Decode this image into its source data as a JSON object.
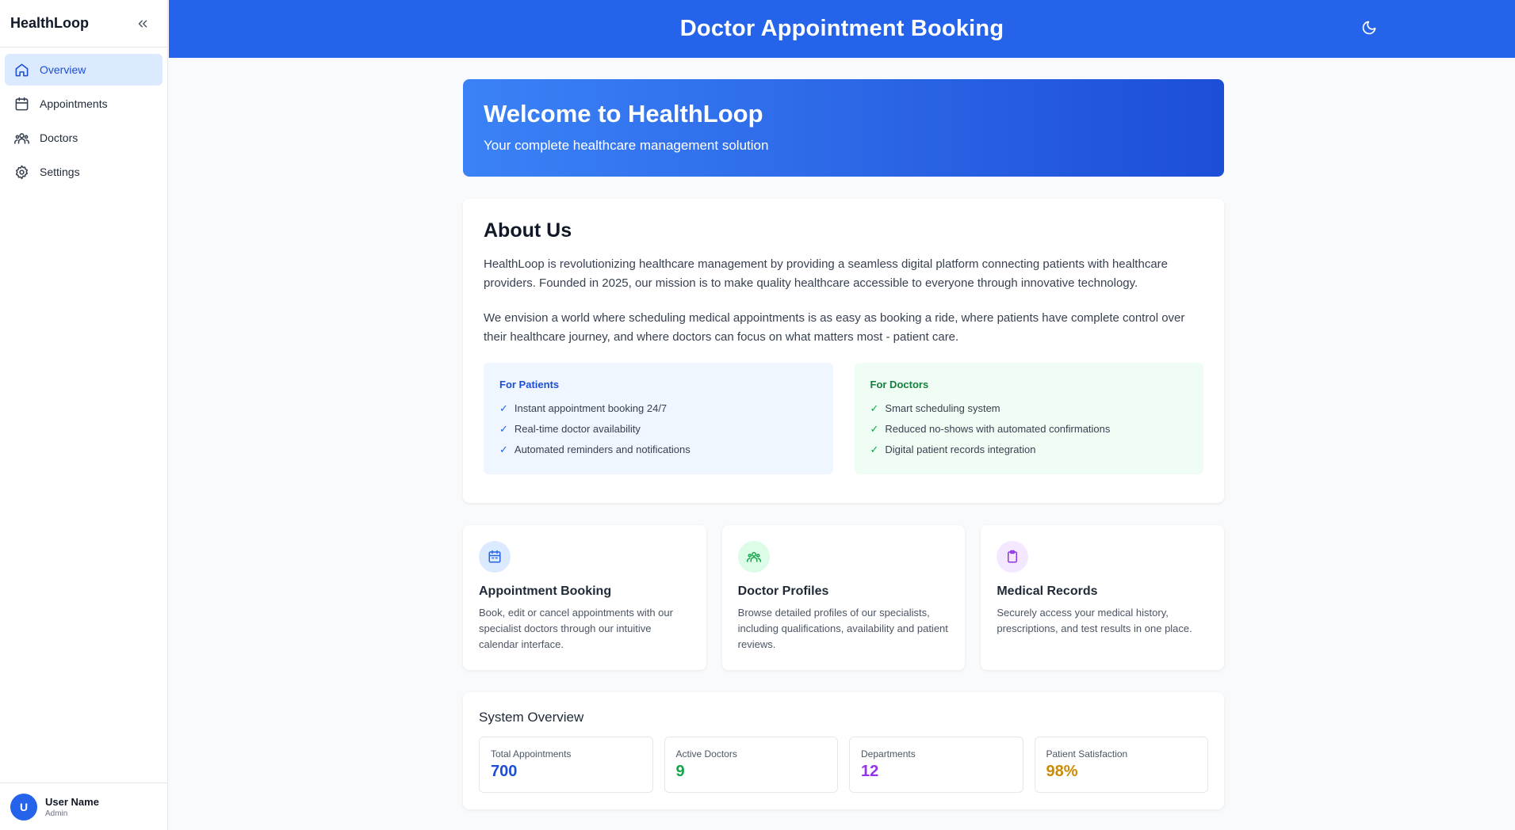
{
  "sidebar": {
    "brand": "HealthLoop",
    "items": [
      {
        "label": "Overview",
        "icon": "home-icon",
        "active": true
      },
      {
        "label": "Appointments",
        "icon": "calendar-icon"
      },
      {
        "label": "Doctors",
        "icon": "users-icon"
      },
      {
        "label": "Settings",
        "icon": "gear-icon"
      }
    ],
    "user": {
      "initial": "U",
      "name": "User Name",
      "role": "Admin"
    }
  },
  "header": {
    "title": "Doctor Appointment Booking",
    "theme_icon": "moon-icon"
  },
  "hero": {
    "title": "Welcome to HealthLoop",
    "subtitle": "Your complete healthcare management solution"
  },
  "about": {
    "title": "About Us",
    "paragraphs": [
      "HealthLoop is revolutionizing healthcare management by providing a seamless digital platform connecting patients with healthcare providers. Founded in 2025, our mission is to make quality healthcare accessible to everyone through innovative technology.",
      "We envision a world where scheduling medical appointments is as easy as booking a ride, where patients have complete control over their healthcare journey, and where doctors can focus on what matters most - patient care."
    ],
    "patients": {
      "title": "For Patients",
      "items": [
        "Instant appointment booking 24/7",
        "Real-time doctor availability",
        "Automated reminders and notifications"
      ]
    },
    "doctors": {
      "title": "For Doctors",
      "items": [
        "Smart scheduling system",
        "Reduced no-shows with automated confirmations",
        "Digital patient records integration"
      ]
    },
    "check": "✓"
  },
  "features": [
    {
      "title": "Appointment Booking",
      "desc": "Book, edit or cancel appointments with our specialist doctors through our intuitive calendar interface.",
      "icon": "calendar-icon",
      "color": "#2563eb",
      "bg": "#dbeafe"
    },
    {
      "title": "Doctor Profiles",
      "desc": "Browse detailed profiles of our specialists, including qualifications, availability and patient reviews.",
      "icon": "users-icon",
      "color": "#16a34a",
      "bg": "#dcfce7"
    },
    {
      "title": "Medical Records",
      "desc": "Securely access your medical history, prescriptions, and test results in one place.",
      "icon": "clipboard-icon",
      "color": "#9333ea",
      "bg": "#f3e8ff"
    }
  ],
  "overview": {
    "title": "System Overview",
    "stats": [
      {
        "label": "Total Appointments",
        "value": "700",
        "color": "#1d4ed8"
      },
      {
        "label": "Active Doctors",
        "value": "9",
        "color": "#16a34a"
      },
      {
        "label": "Departments",
        "value": "12",
        "color": "#9333ea"
      },
      {
        "label": "Patient Satisfaction",
        "value": "98%",
        "color": "#ca8a04"
      }
    ]
  },
  "colors": {
    "accent": "#2563eb",
    "hero_start": "#3b82f6",
    "hero_end": "#1d4ed8"
  }
}
